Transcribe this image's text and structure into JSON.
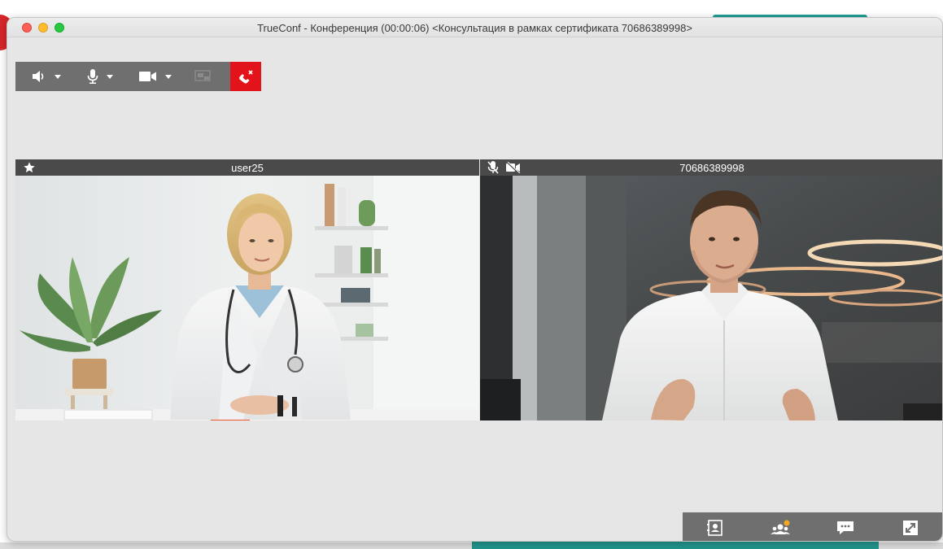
{
  "window": {
    "title": "TrueConf - Конференция (00:00:06) <Консультация в рамках сертификата 70686389998>"
  },
  "toolbar": {
    "speaker_icon": "speaker-icon",
    "mic_icon": "microphone-icon",
    "camera_icon": "video-camera-icon",
    "screen_share_icon": "screen-share-icon",
    "hangup_icon": "hang-up-icon",
    "hangup_color": "#e3131b"
  },
  "participants": [
    {
      "name": "user25",
      "badge_icon": "star-icon"
    },
    {
      "name": "70686389998",
      "status_icons": [
        "mic-muted-icon",
        "camera-off-icon"
      ]
    }
  ],
  "bottombar": {
    "icons": [
      "contacts-icon",
      "participants-icon",
      "chat-icon",
      "fullscreen-icon"
    ],
    "notification_color": "#f5a623"
  },
  "colors": {
    "toolbar_bg": "#6f6f6f",
    "window_bg": "#e6e6e6",
    "panel_header_bg": "#4a4a4a"
  }
}
